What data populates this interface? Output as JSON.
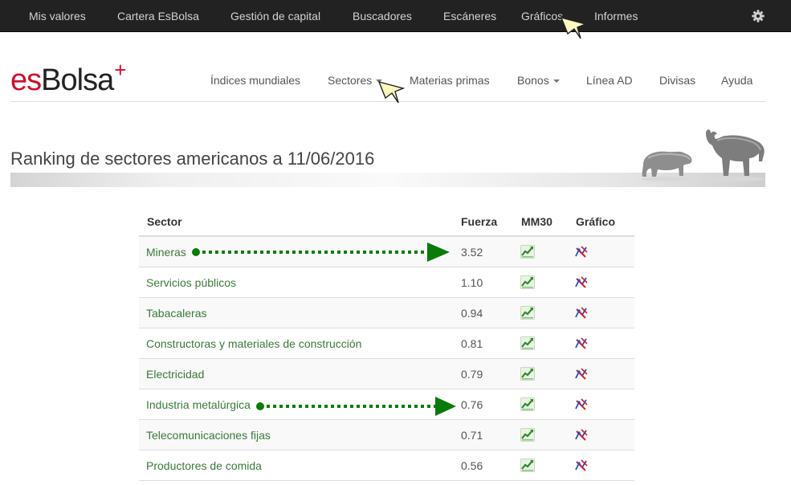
{
  "topbar": {
    "items": [
      "Mis valores",
      "Cartera EsBolsa",
      "Gestión de capital",
      "Buscadores",
      "Escáneres",
      "Gráficos",
      "Informes"
    ],
    "settings_icon": "gear-icon"
  },
  "logo": {
    "es": "es",
    "bolsa": "Bolsa",
    "plus": "+"
  },
  "nav": {
    "items": [
      "Índices mundiales",
      "Sectores",
      "Materias primas",
      "Bonos",
      "Línea AD",
      "Divisas",
      "Ayuda"
    ]
  },
  "banner": {
    "title": "Ranking de sectores americanos a 11/06/2016",
    "images": [
      "bear-icon",
      "bull-icon"
    ]
  },
  "table": {
    "headers": [
      "Sector",
      "Fuerza",
      "MM30",
      "Gráfico"
    ],
    "rows": [
      {
        "sector": "Mineras",
        "fuerza": "3.52"
      },
      {
        "sector": "Servicios públicos",
        "fuerza": "1.10"
      },
      {
        "sector": "Tabacaleras",
        "fuerza": "0.94"
      },
      {
        "sector": "Constructoras y materiales de construcción",
        "fuerza": "0.81"
      },
      {
        "sector": "Electricidad",
        "fuerza": "0.79"
      },
      {
        "sector": "Industria metalúrgica",
        "fuerza": "0.76"
      },
      {
        "sector": "Telecomunicaciones fijas",
        "fuerza": "0.71"
      },
      {
        "sector": "Productores de comida",
        "fuerza": "0.56"
      }
    ],
    "mm30_icon": "trend-chart-icon",
    "grafico_icon": "chart-tool-icon"
  },
  "colors": {
    "topbar_bg": "#222222",
    "link_green": "#3a7a3a",
    "brand_red": "#c8102e",
    "annotation_green": "#0a7a0a",
    "cursor_yellow": "#fff8c0"
  }
}
